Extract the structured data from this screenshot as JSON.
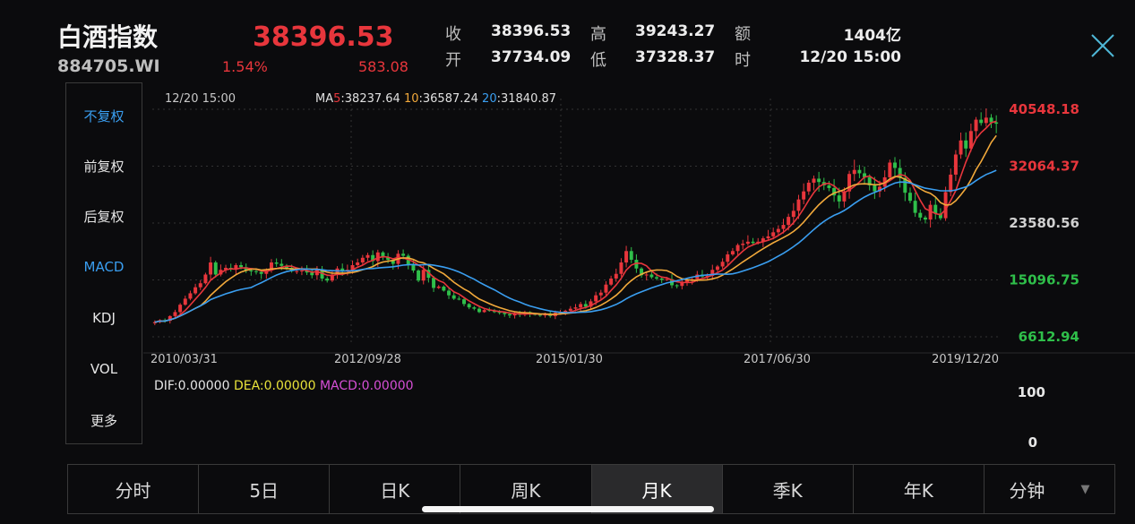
{
  "header": {
    "name": "白酒指数",
    "code": "884705.WI",
    "price": "38396.53",
    "change_pct": "1.54%",
    "change": "583.08",
    "stats": [
      {
        "label": "收",
        "value": "38396.53"
      },
      {
        "label": "高",
        "value": "39243.27"
      },
      {
        "label": "额",
        "value": "1404亿"
      },
      {
        "label": "开",
        "value": "37734.09"
      },
      {
        "label": "低",
        "value": "37328.37"
      },
      {
        "label": "时",
        "value": "12/20 15:00"
      }
    ]
  },
  "side_menu": [
    "不复权",
    "前复权",
    "后复权",
    "MACD",
    "KDJ",
    "VOL",
    "更多"
  ],
  "tabs": [
    "分时",
    "5日",
    "日K",
    "周K",
    "月K",
    "季K",
    "年K",
    "分钟"
  ],
  "active_tab": "月K",
  "colors": {
    "up": "#e8363c",
    "down": "#2fbf4a",
    "ma5": "#e8363c",
    "ma10": "#f2a93b",
    "ma20": "#3a9ef0",
    "dea": "#e8e23a",
    "macd": "#d64fd6",
    "accent": "#3a9ef0"
  },
  "chart_data": {
    "type": "candlestick",
    "info_time": "12/20 15:00",
    "ma": [
      {
        "prefix": "MA",
        "period": "5",
        "value": ":38237.64"
      },
      {
        "period": "10",
        "value": ":36587.24"
      },
      {
        "period": "20",
        "value": ":31840.87"
      }
    ],
    "y_ticks": [
      "40548.18",
      "32064.37",
      "23580.56",
      "15096.75",
      "6612.94"
    ],
    "ylim": [
      6612.94,
      40548.18
    ],
    "x_ticks": [
      "2010/03/31",
      "2012/09/28",
      "2015/01/30",
      "2017/06/30",
      "2019/12/20"
    ],
    "closes": [
      8800,
      9100,
      9000,
      9700,
      10300,
      11400,
      12300,
      13100,
      14000,
      14600,
      15900,
      17700,
      15900,
      16600,
      16900,
      16700,
      17300,
      17000,
      16500,
      16400,
      16300,
      16000,
      16500,
      17700,
      17500,
      17200,
      16900,
      16400,
      16400,
      16500,
      16200,
      15800,
      16700,
      15300,
      15000,
      15900,
      16800,
      16500,
      16600,
      17300,
      17700,
      18400,
      18800,
      17900,
      19200,
      18500,
      18100,
      17500,
      19000,
      18700,
      17400,
      16500,
      15000,
      16600,
      15400,
      13900,
      14100,
      13500,
      12800,
      12300,
      12200,
      11500,
      11000,
      10800,
      10300,
      10600,
      10500,
      10300,
      10200,
      10000,
      9800,
      10100,
      9900,
      10300,
      10000,
      9900,
      9800,
      10100,
      9700,
      10200,
      10300,
      10500,
      10800,
      11000,
      11500,
      11100,
      11900,
      12800,
      13200,
      14400,
      15300,
      16000,
      17700,
      19400,
      18100,
      16800,
      15800,
      15900,
      15500,
      15300,
      15100,
      15200,
      14300,
      14200,
      14800,
      15100,
      15200,
      15900,
      15600,
      15700,
      16600,
      17100,
      17800,
      18900,
      19400,
      20300,
      20500,
      20800,
      20600,
      20800,
      21300,
      21600,
      22200,
      22700,
      23300,
      24500,
      25400,
      27100,
      28300,
      29600,
      30200,
      29700,
      29200,
      28800,
      27700,
      26800,
      28300,
      30900,
      31500,
      31000,
      30400,
      29200,
      28300,
      29000,
      30400,
      32600,
      31800,
      30300,
      28100,
      26900,
      25100,
      24400,
      24100,
      26300,
      25000,
      24300,
      28200,
      30800,
      33800,
      35900,
      34700,
      37300,
      39000,
      38500,
      39300,
      38600,
      38396.53
    ],
    "ma5_last": 38237.64,
    "ma10_last": 36587.24,
    "ma20_last": 31840.87,
    "macd": {
      "dif": "DIF:0.00000",
      "dea": "DEA:0.00000",
      "macd": "MACD:0.00000"
    },
    "volume_ticks": [
      "100",
      "0"
    ]
  }
}
